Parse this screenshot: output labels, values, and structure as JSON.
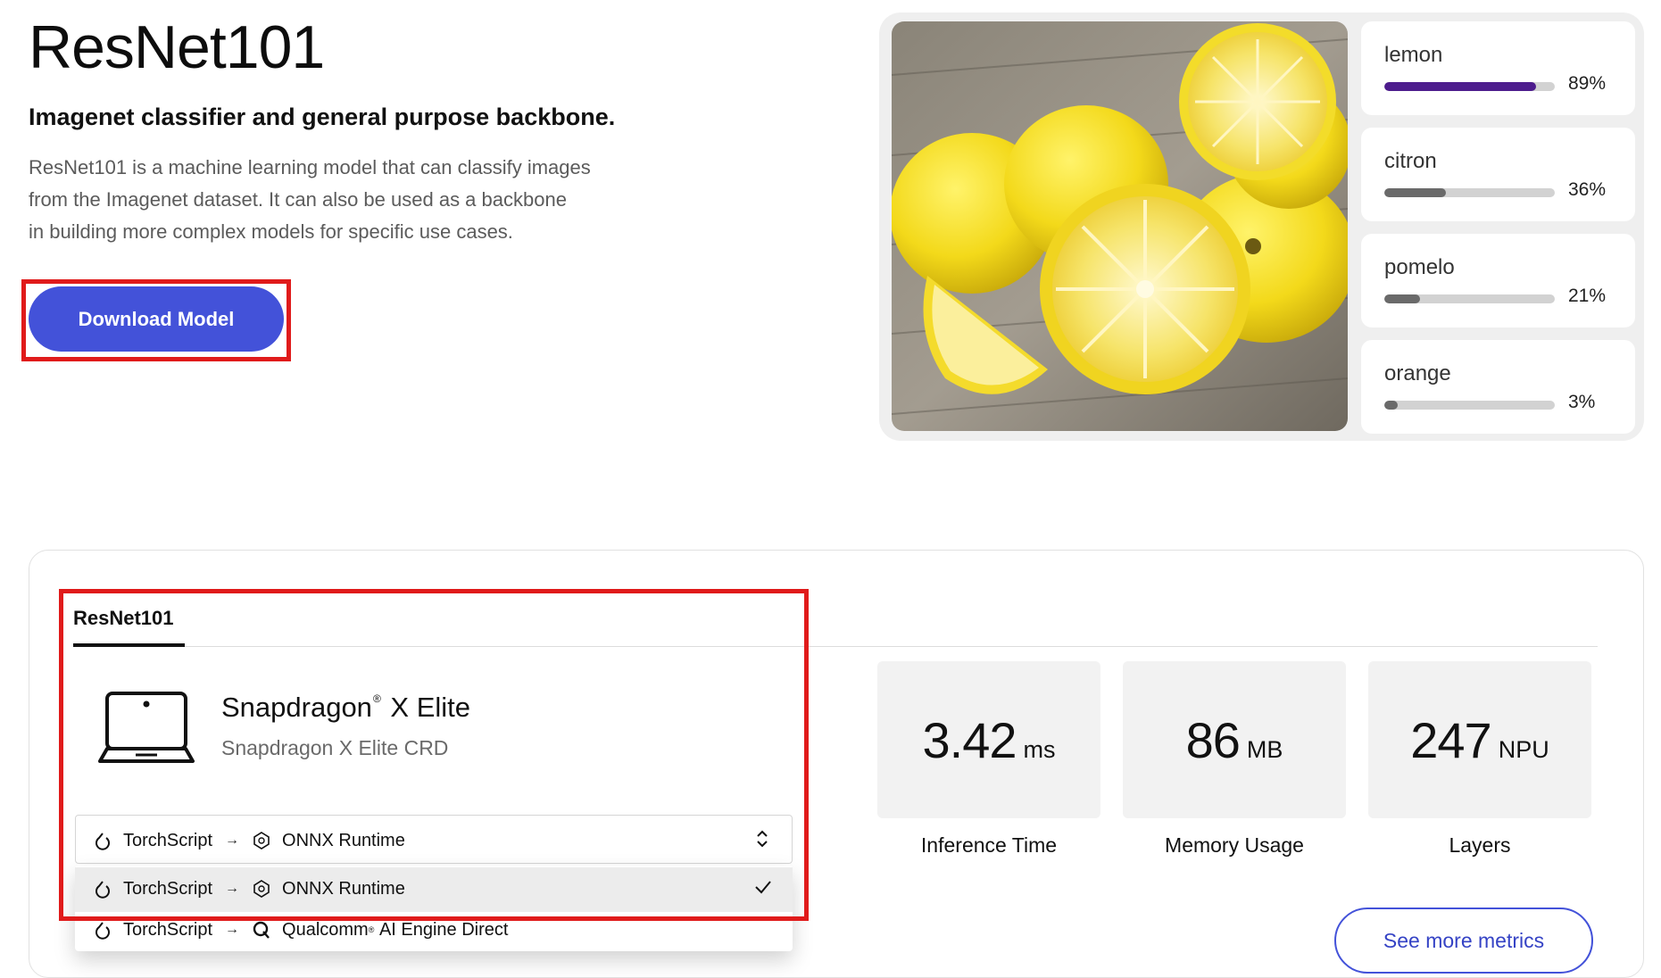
{
  "hero": {
    "title": "ResNet101",
    "subtitle": "Imagenet classifier and general purpose backbone.",
    "description_lines": [
      "ResNet101 is a machine learning model that can classify images",
      "from the Imagenet dataset. It can also be used as a backbone",
      "in building more complex models for specific use cases."
    ],
    "download_label": "Download Model"
  },
  "demo": {
    "predictions": [
      {
        "label": "lemon",
        "percent": "89%",
        "fraction": 0.89
      },
      {
        "label": "citron",
        "percent": "36%",
        "fraction": 0.36
      },
      {
        "label": "pomelo",
        "percent": "21%",
        "fraction": 0.21
      },
      {
        "label": "orange",
        "percent": "3%",
        "fraction": 0.03
      }
    ]
  },
  "metrics_panel": {
    "tab_label": "ResNet101",
    "device": {
      "name_prefix": "Snapdragon",
      "name_mark": "®",
      "name_suffix": "X Elite",
      "subtitle": "Snapdragon X Elite CRD"
    },
    "runtime_select": {
      "from": "TorchScript",
      "to": "ONNX Runtime"
    },
    "runtime_options": [
      {
        "from": "TorchScript",
        "to": "ONNX Runtime",
        "selected": true
      },
      {
        "from": "TorchScript",
        "to_prefix": "Qualcomm",
        "to_mark": "®",
        "to_suffix": "AI Engine Direct",
        "selected": false
      }
    ],
    "metrics": [
      {
        "value": "3.42",
        "unit": "ms",
        "label": "Inference Time"
      },
      {
        "value": "86",
        "unit": "MB",
        "label": "Memory Usage"
      },
      {
        "value": "247",
        "unit": "NPU",
        "label": "Layers"
      }
    ],
    "more_label": "See more metrics"
  },
  "colors": {
    "accent": "#4352d9",
    "top_prediction_bar": "#4d1c8d",
    "highlight": "#e01b1b"
  }
}
